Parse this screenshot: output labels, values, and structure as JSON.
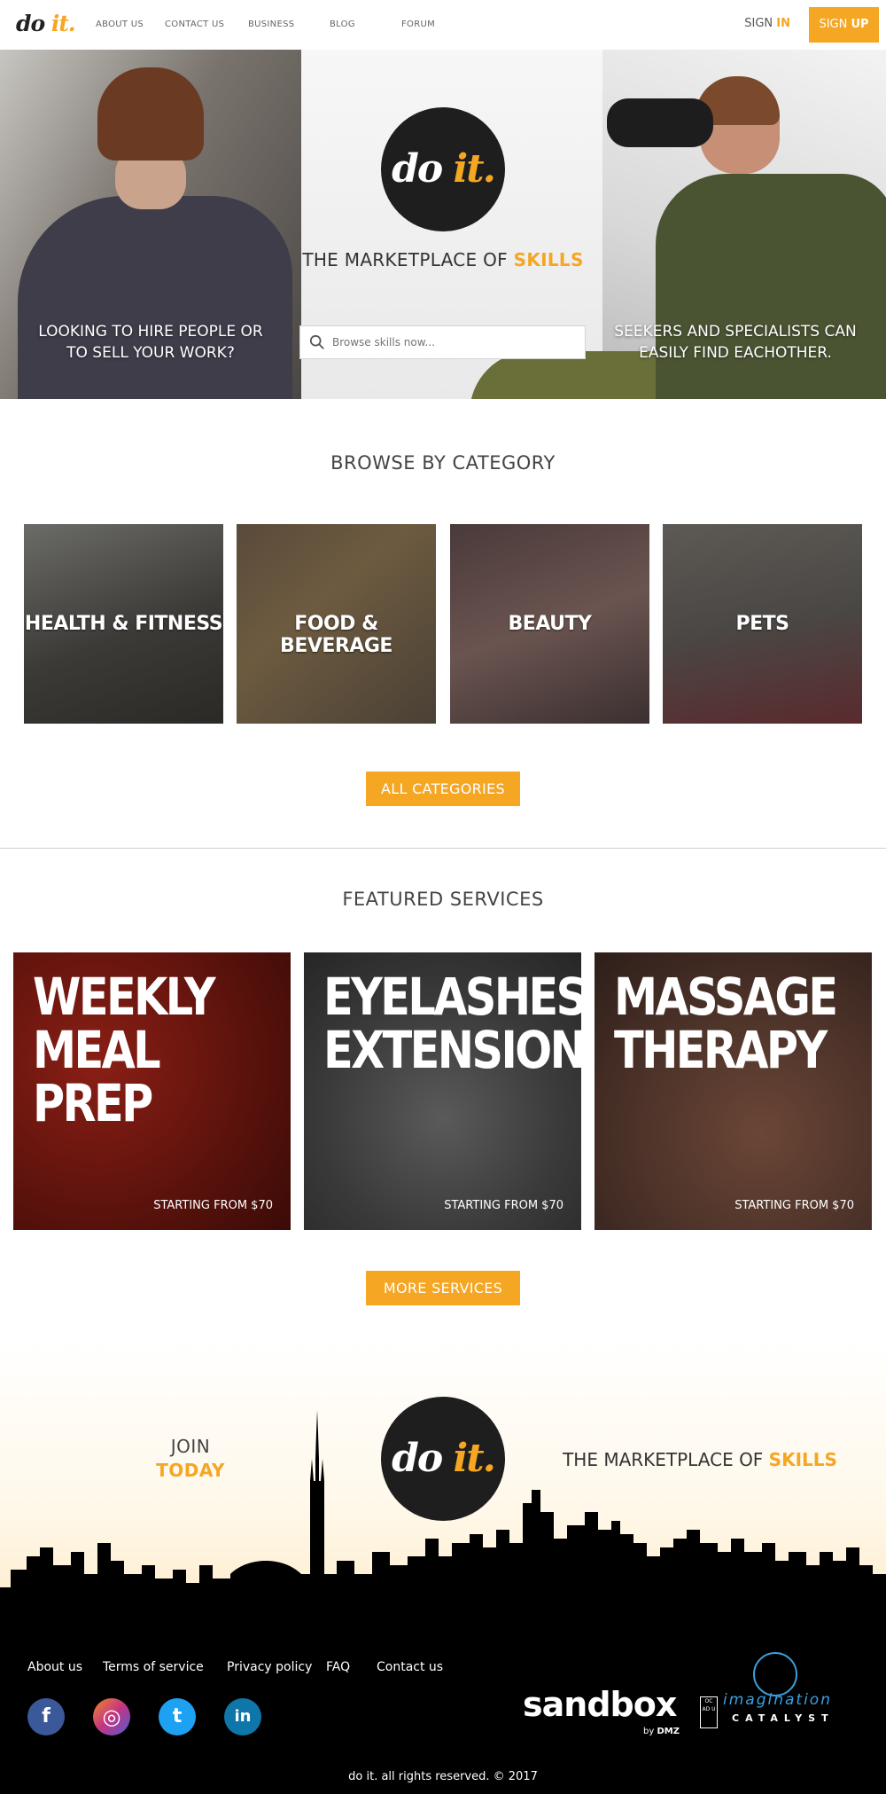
{
  "nav": {
    "logo_do": "do",
    "logo_it": "it.",
    "links": [
      "ABOUT US",
      "CONTACT US",
      "BUSINESS",
      "BLOG",
      "FORUM"
    ],
    "signin_prefix": "SIGN",
    "signin_suffix": "IN",
    "signup_prefix": "SIGN",
    "signup_suffix": "UP"
  },
  "hero": {
    "logo_do": "do",
    "logo_it": "it.",
    "tagline_prefix": "THE MARKETPLACE OF",
    "tagline_highlight": "SKILLS",
    "left_text": "LOOKING TO HIRE PEOPLE OR TO SELL YOUR WORK?",
    "right_text": "SEEKERS AND SPECIALISTS CAN EASILY FIND EACHOTHER.",
    "search_placeholder": "Browse skills now..."
  },
  "browse": {
    "title": "BROWSE BY CATEGORY",
    "categories": [
      {
        "label": "HEALTH & FITNESS"
      },
      {
        "label": "FOOD & BEVERAGE"
      },
      {
        "label": "BEAUTY"
      },
      {
        "label": "PETS"
      }
    ],
    "button": "ALL CATEGORIES"
  },
  "featured": {
    "title": "FEATURED SERVICES",
    "services": [
      {
        "title": "WEEKLY MEAL PREP",
        "price": "STARTING FROM $70"
      },
      {
        "title": "EYELASHES EXTENSIONS",
        "price": "STARTING FROM $70"
      },
      {
        "title": "MASSAGE THERAPY",
        "price": "STARTING FROM $70"
      }
    ],
    "button": "MORE SERVICES"
  },
  "join": {
    "line1": "JOIN",
    "line2": "TODAY",
    "logo_do": "do",
    "logo_it": "it.",
    "tagline_prefix": "THE MARKETPLACE OF",
    "tagline_highlight": "SKILLS"
  },
  "footer": {
    "links": [
      "About us",
      "Terms of service",
      "Privacy policy",
      "FAQ",
      "Contact us"
    ],
    "social": [
      {
        "name": "facebook",
        "glyph": "f",
        "color": "#3b5998"
      },
      {
        "name": "instagram",
        "glyph": "◎",
        "color": "#c13584"
      },
      {
        "name": "twitter",
        "glyph": "t",
        "color": "#1da1f2"
      },
      {
        "name": "linkedin",
        "glyph": "in",
        "color": "#0e76a8"
      }
    ],
    "sandbox": "sandbox",
    "sandbox_by": "by",
    "sandbox_dmz": "DMZ",
    "ocad": "OC AD U",
    "imagination": "imagination",
    "catalyst": "CATALYST",
    "copyright": "do it. all rights reserved. © 2017"
  },
  "colors": {
    "accent": "#f5a623",
    "footer_bg": "#000000"
  }
}
